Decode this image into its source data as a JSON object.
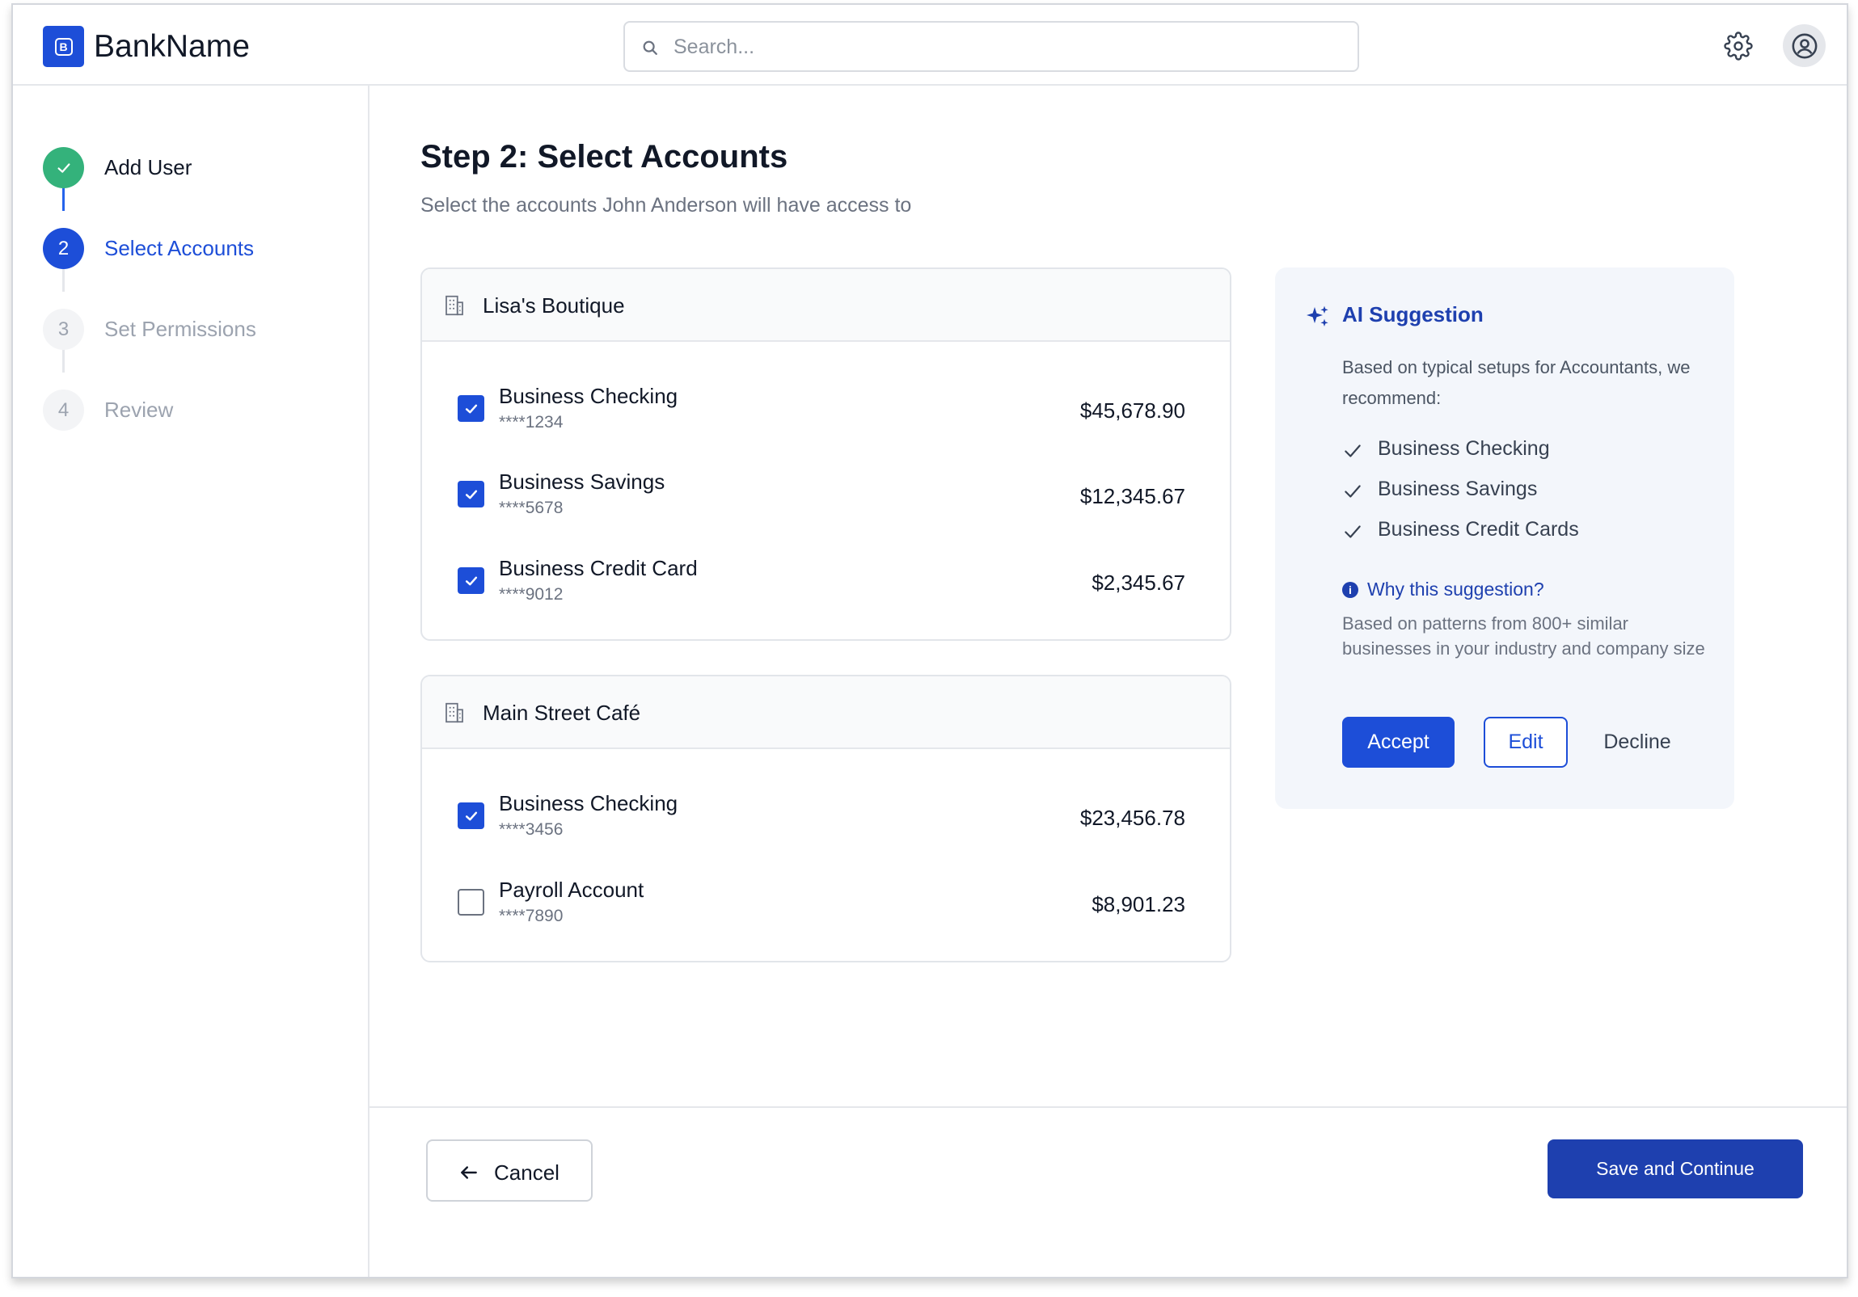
{
  "header": {
    "logo_letter": "B",
    "brand": "BankName",
    "search_placeholder": "Search..."
  },
  "steps": [
    {
      "number": "1",
      "label": "Add User",
      "state": "complete"
    },
    {
      "number": "2",
      "label": "Select Accounts",
      "state": "active"
    },
    {
      "number": "3",
      "label": "Set Permissions",
      "state": "pending"
    },
    {
      "number": "4",
      "label": "Review",
      "state": "pending"
    }
  ],
  "main": {
    "title": "Step 2: Select Accounts",
    "subtitle": "Select the accounts John Anderson will have access to"
  },
  "businesses": [
    {
      "name": "Lisa's Boutique",
      "accounts": [
        {
          "name": "Business Checking",
          "number": "****1234",
          "balance": "$45,678.90",
          "checked": true
        },
        {
          "name": "Business Savings",
          "number": "****5678",
          "balance": "$12,345.67",
          "checked": true
        },
        {
          "name": "Business Credit Card",
          "number": "****9012",
          "balance": "$2,345.67",
          "checked": true
        }
      ]
    },
    {
      "name": "Main Street Café",
      "accounts": [
        {
          "name": "Business Checking",
          "number": "****3456",
          "balance": "$23,456.78",
          "checked": true
        },
        {
          "name": "Payroll Account",
          "number": "****7890",
          "balance": "$8,901.23",
          "checked": false
        }
      ]
    }
  ],
  "ai": {
    "title": "AI Suggestion",
    "intro": "Based on typical setups for Accountants, we recommend:",
    "recommendations": [
      "Business Checking",
      "Business Savings",
      "Business Credit Cards"
    ],
    "why_label": "Why this suggestion?",
    "why_desc": "Based on patterns from 800+ similar businesses in your industry and company size",
    "accept_label": "Accept",
    "edit_label": "Edit",
    "decline_label": "Decline"
  },
  "footer": {
    "cancel_label": "Cancel",
    "save_label": "Save and Continue"
  },
  "colors": {
    "primary": "#1d4ed8",
    "primary_dark": "#1e40af",
    "success": "#34b27b",
    "muted": "#9ca3af"
  }
}
